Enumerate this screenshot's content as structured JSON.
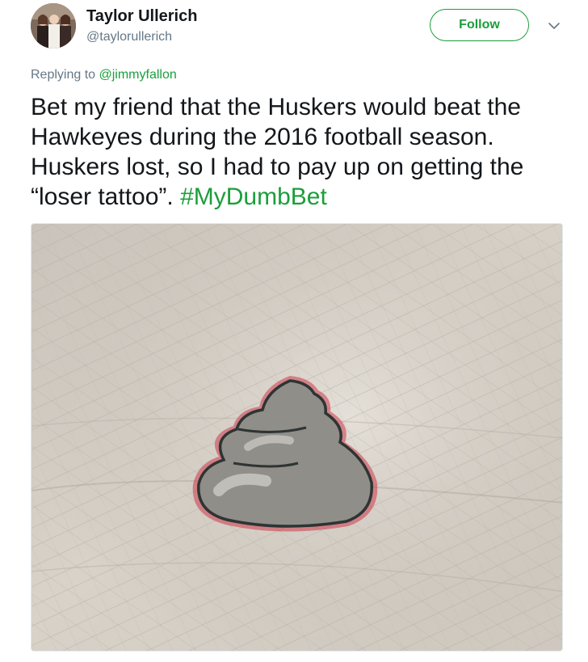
{
  "author": {
    "display_name": "Taylor Ullerich",
    "handle": "@taylorullerich"
  },
  "follow_button": {
    "label": "Follow"
  },
  "icons": {
    "avatar": "avatar-photo",
    "more": "chevron-down-icon"
  },
  "colors": {
    "accent": "#1b9e3b",
    "secondary_text": "#657786",
    "primary_text": "#14171a"
  },
  "reply_context": {
    "prefix": "Replying to ",
    "mention": "@jimmyfallon"
  },
  "tweet": {
    "text": "Bet my friend that the Huskers would beat the Hawkeyes during the 2016 football season. Huskers lost, so I had to pay up on getting the “loser tattoo”. ",
    "hashtag": "#MyDumbBet"
  }
}
